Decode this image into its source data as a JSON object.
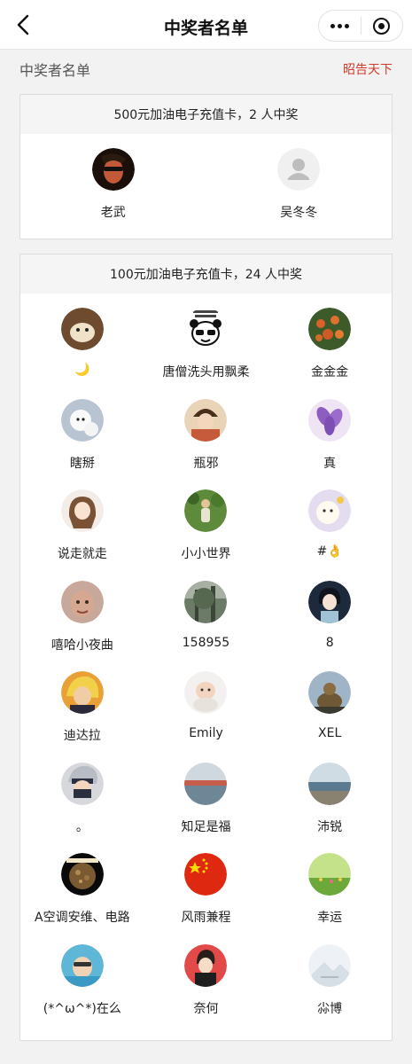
{
  "nav": {
    "title": "中奖者名单",
    "back_icon": "chevron-left-icon",
    "more_icon": "more-dots-icon",
    "close_icon": "target-icon"
  },
  "header": {
    "title": "中奖者名单",
    "announce_label": "昭告天下",
    "announce_color": "#d23b2b"
  },
  "prizes": [
    {
      "title": "500元加油电子充值卡，2 人中奖",
      "winners": [
        {
          "name": "老武",
          "avatar": "portrait-sunglasses"
        },
        {
          "name": "吴冬冬",
          "avatar": "default-user-icon"
        }
      ]
    },
    {
      "title": "100元加油电子充值卡，24 人中奖",
      "winners": [
        {
          "name": "🌙",
          "avatar": "puppy-photo"
        },
        {
          "name": "唐僧洗头用飘柔",
          "avatar": "panda-meme"
        },
        {
          "name": "金金金",
          "avatar": "fruit-tree"
        },
        {
          "name": "瞎掰",
          "avatar": "white-dog"
        },
        {
          "name": "瓶邪",
          "avatar": "anime-boy"
        },
        {
          "name": "真",
          "avatar": "purple-flower"
        },
        {
          "name": "说走就走",
          "avatar": "anime-girl"
        },
        {
          "name": "小小世界",
          "avatar": "person-in-park"
        },
        {
          "name": "#👌",
          "avatar": "cartoon-sheep"
        },
        {
          "name": "嘻哈小夜曲",
          "avatar": "baby-photo"
        },
        {
          "name": "158955",
          "avatar": "forest"
        },
        {
          "name": "8",
          "avatar": "anime-girl-dark"
        },
        {
          "name": "迪达拉",
          "avatar": "naruto-deidara"
        },
        {
          "name": "Emily",
          "avatar": "baby-lying"
        },
        {
          "name": "XEL",
          "avatar": "buddha-statue"
        },
        {
          "name": "。",
          "avatar": "kakashi"
        },
        {
          "name": "知足是福",
          "avatar": "lake-view"
        },
        {
          "name": "沛锐",
          "avatar": "sea-coast"
        },
        {
          "name": "A空调安维、电路",
          "avatar": "logo-dark"
        },
        {
          "name": "风雨兼程",
          "avatar": "china-flag"
        },
        {
          "name": "幸运",
          "avatar": "green-field"
        },
        {
          "name": "(*^ω^*)在么",
          "avatar": "child-pool"
        },
        {
          "name": "奈何",
          "avatar": "cartoon-person-red"
        },
        {
          "name": "尛博",
          "avatar": "snow-landscape"
        }
      ]
    }
  ]
}
